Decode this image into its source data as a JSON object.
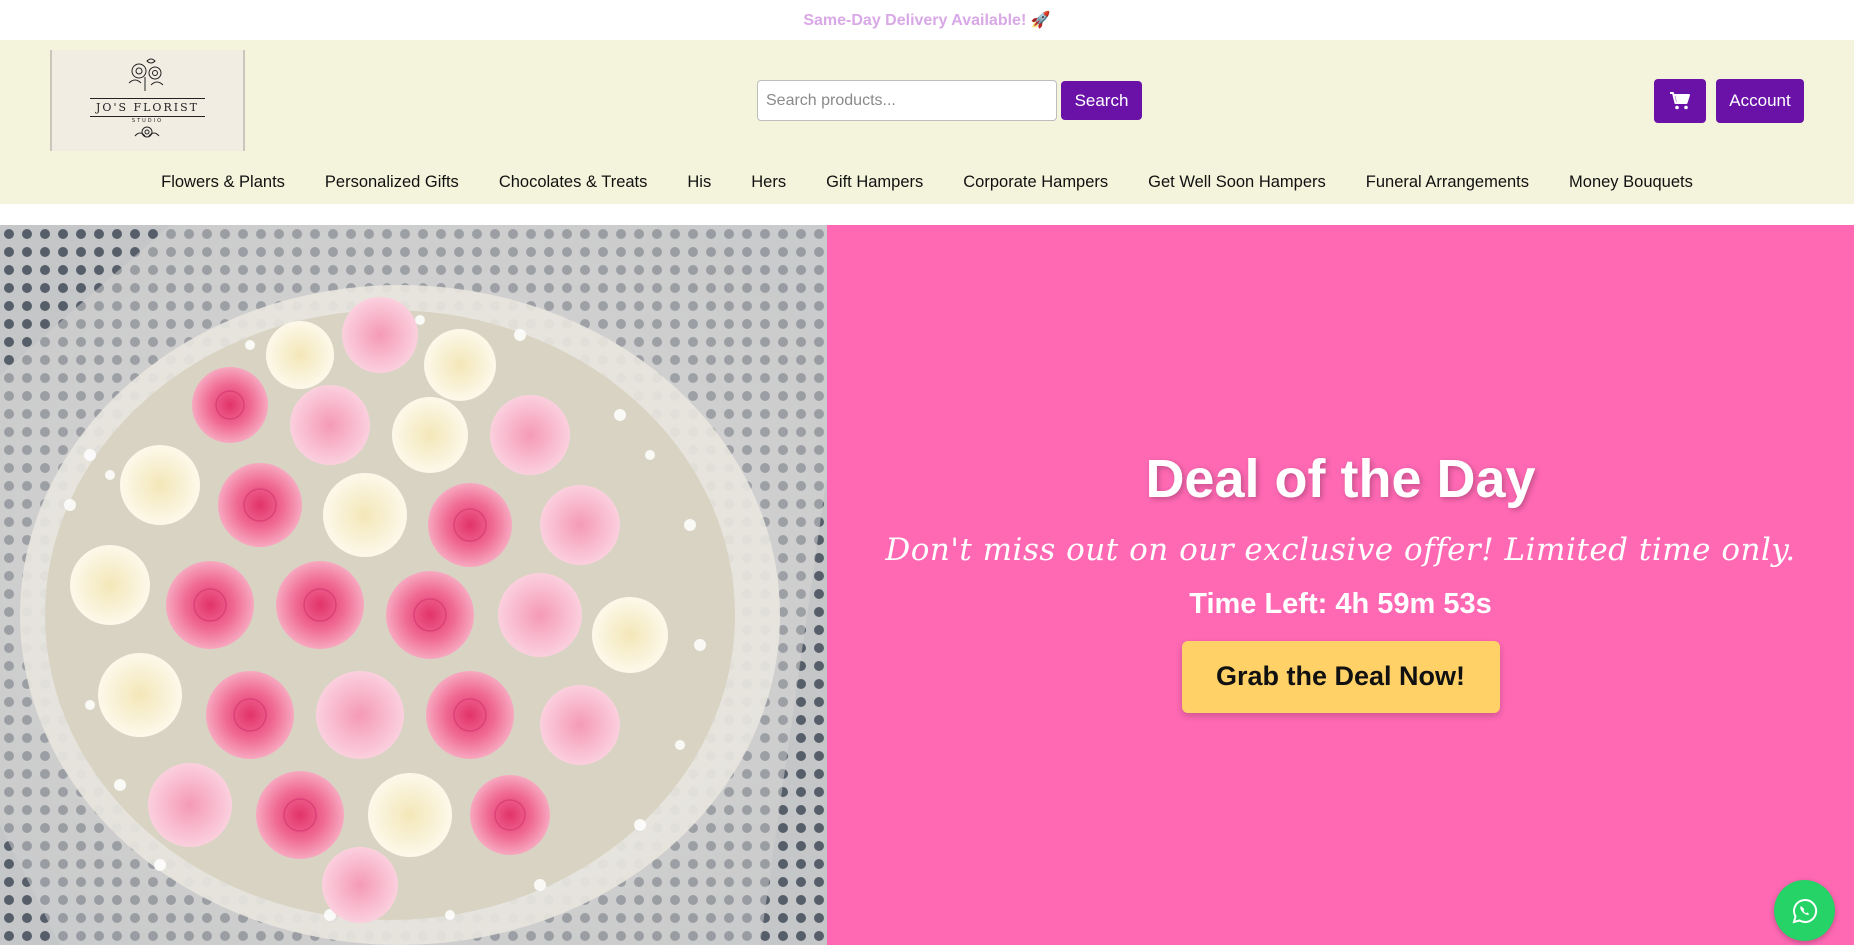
{
  "announcement": {
    "text": "Same-Day Delivery Available! 🚀"
  },
  "logo": {
    "name": "JO'S FLORIST",
    "sub": "STUDIO"
  },
  "search": {
    "placeholder": "Search products...",
    "button_label": "Search"
  },
  "header_actions": {
    "cart_icon": "cart-icon",
    "account_label": "Account"
  },
  "nav": {
    "items": [
      {
        "label": "Flowers & Plants"
      },
      {
        "label": "Personalized Gifts"
      },
      {
        "label": "Chocolates & Treats"
      },
      {
        "label": "His"
      },
      {
        "label": "Hers"
      },
      {
        "label": "Gift Hampers"
      },
      {
        "label": "Corporate Hampers"
      },
      {
        "label": "Get Well Soon Hampers"
      },
      {
        "label": "Funeral Arrangements"
      },
      {
        "label": "Money Bouquets"
      }
    ]
  },
  "deal": {
    "title": "Deal of the Day",
    "subtitle": "Don't miss out on our exclusive offer! Limited time only.",
    "timer": "Time Left: 4h 59m 53s",
    "button_label": "Grab the Deal Now!"
  },
  "whatsapp": {
    "icon": "whatsapp-icon"
  },
  "colors": {
    "header_bg": "#f4f4dc",
    "brand_purple": "#6a12a8",
    "hero_pink": "#ff69b4",
    "deal_button": "#ffd166",
    "whatsapp_green": "#25d366",
    "announcement_text": "#d9a8e6"
  }
}
